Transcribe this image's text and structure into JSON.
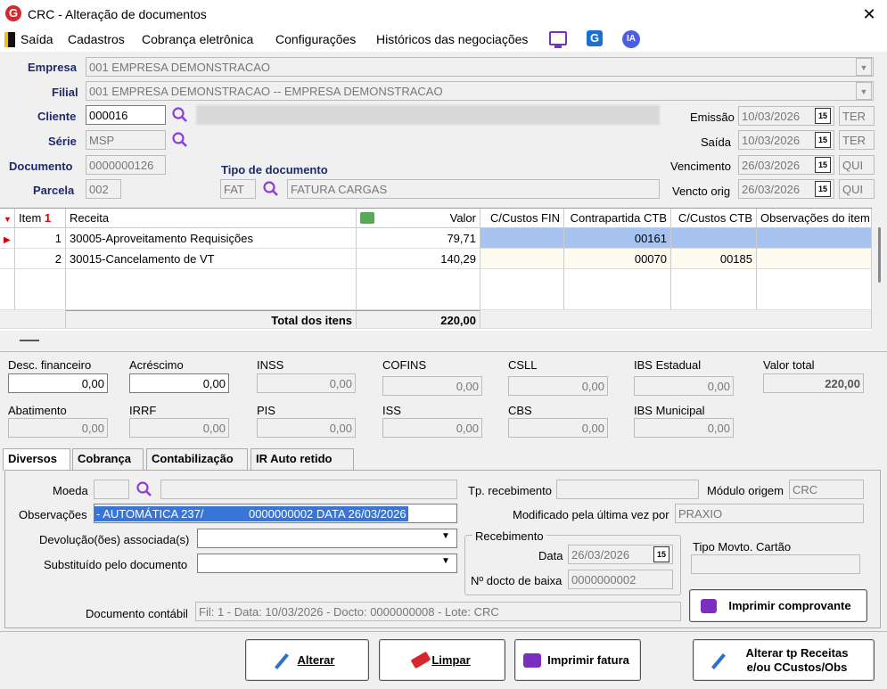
{
  "window": {
    "title": "CRC - Alteração de documentos",
    "logo_letter": "G",
    "close": "✕"
  },
  "menu": {
    "items": [
      "Saída",
      "Cadastros",
      "Cobrança eletrônica",
      "Configurações",
      "Históricos das negociações"
    ],
    "ia_label": "IA",
    "g_label": "G"
  },
  "header": {
    "empresa_label": "Empresa",
    "empresa_value": "001 EMPRESA DEMONSTRACAO",
    "filial_label": "Filial",
    "filial_value": "001 EMPRESA DEMONSTRACAO -- EMPRESA DEMONSTRACAO",
    "cliente_label": "Cliente",
    "cliente_value": "000016",
    "serie_label": "Série",
    "serie_value": "MSP",
    "documento_label": "Documento",
    "documento_value": "0000000126",
    "parcela_label": "Parcela",
    "parcela_value": "002",
    "tipo_doc_label": "Tipo de documento",
    "tipo_doc_code": "FAT",
    "tipo_doc_desc": "FATURA CARGAS",
    "emissao_label": "Emissão",
    "emissao_value": "10/03/2026",
    "emissao_day": "TER",
    "saida_label": "Saída",
    "saida_value": "10/03/2026",
    "saida_day": "TER",
    "vencimento_label": "Vencimento",
    "vencimento_value": "26/03/2026",
    "vencimento_day": "QUI",
    "vencto_orig_label": "Vencto orig",
    "vencto_orig_value": "26/03/2026",
    "vencto_orig_day": "QUI",
    "cal_label": "15"
  },
  "grid": {
    "columns": [
      "Item",
      "Receita",
      "Valor",
      "C/Custos FIN",
      "Contrapartida CTB",
      "C/Custos CTB",
      "Observações do item"
    ],
    "sort_glyph": "1",
    "rows": [
      {
        "item": "1",
        "receita": "30005-Aproveitamento Requisições",
        "valor": "79,71",
        "ccfin": "",
        "contra": "00161",
        "ccctb": "",
        "obs": ""
      },
      {
        "item": "2",
        "receita": "30015-Cancelamento de VT",
        "valor": "140,29",
        "ccfin": "",
        "contra": "00070",
        "ccctb": "00185",
        "obs": ""
      }
    ],
    "total_label": "Total dos itens",
    "total_value": "220,00"
  },
  "totals": {
    "desc_fin_label": "Desc. financeiro",
    "desc_fin": "0,00",
    "acrescimo_label": "Acréscimo",
    "acrescimo": "0,00",
    "inss_label": "INSS",
    "inss": "0,00",
    "cofins_label": "COFINS",
    "cofins": "0,00",
    "csll_label": "CSLL",
    "csll": "0,00",
    "ibs_est_label": "IBS Estadual",
    "ibs_est": "0,00",
    "valor_total_label": "Valor total",
    "valor_total": "220,00",
    "abatimento_label": "Abatimento",
    "abatimento": "0,00",
    "irrf_label": "IRRF",
    "irrf": "0,00",
    "pis_label": "PIS",
    "pis": "0,00",
    "iss_label": "ISS",
    "iss": "0,00",
    "cbs_label": "CBS",
    "cbs": "0,00",
    "ibs_mun_label": "IBS Municipal",
    "ibs_mun": "0,00"
  },
  "tabs": [
    "Diversos",
    "Cobrança",
    "Contabilização",
    "IR Auto retido"
  ],
  "diversos": {
    "moeda_label": "Moeda",
    "moeda_value": "",
    "tp_receb_label": "Tp. recebimento",
    "tp_receb_value": "",
    "modulo_label": "Módulo origem",
    "modulo_value": "CRC",
    "obs_label": "Observações",
    "obs_value": "- AUTOMÁTICA 237/              0000000002 DATA 26/03/2026",
    "modificado_label": "Modificado pela última vez por",
    "modificado_value": "PRAXIO",
    "devolucao_label": "Devolução(ões) associada(s)",
    "substituido_label": "Substituído pelo documento",
    "receb_group": "Recebimento",
    "data_label": "Data",
    "data_value": "26/03/2026",
    "ndocto_label": "Nº docto de baixa",
    "ndocto_value": "0000000002",
    "tipo_cartao_label": "Tipo Movto. Cartão",
    "tipo_cartao_value": "",
    "doc_contabil_label": "Documento contábil",
    "doc_contabil_value": "Fil: 1 - Data: 10/03/2026 - Docto: 0000000008 - Lote: CRC",
    "imprimir_comp": "Imprimir comprovante"
  },
  "buttons": {
    "alterar": "Alterar",
    "limpar": "Limpar",
    "imprimir_fatura": "Imprimir fatura",
    "alterar_tp_1": "Alterar tp Receitas",
    "alterar_tp_2": "e/ou CCustos/Obs"
  },
  "colors": {
    "accent": "#1f2a6b",
    "selection": "#3875d7",
    "row_highlight": "#a7c3ef",
    "brand_red": "#d8262b",
    "purple": "#7b2fbf"
  }
}
